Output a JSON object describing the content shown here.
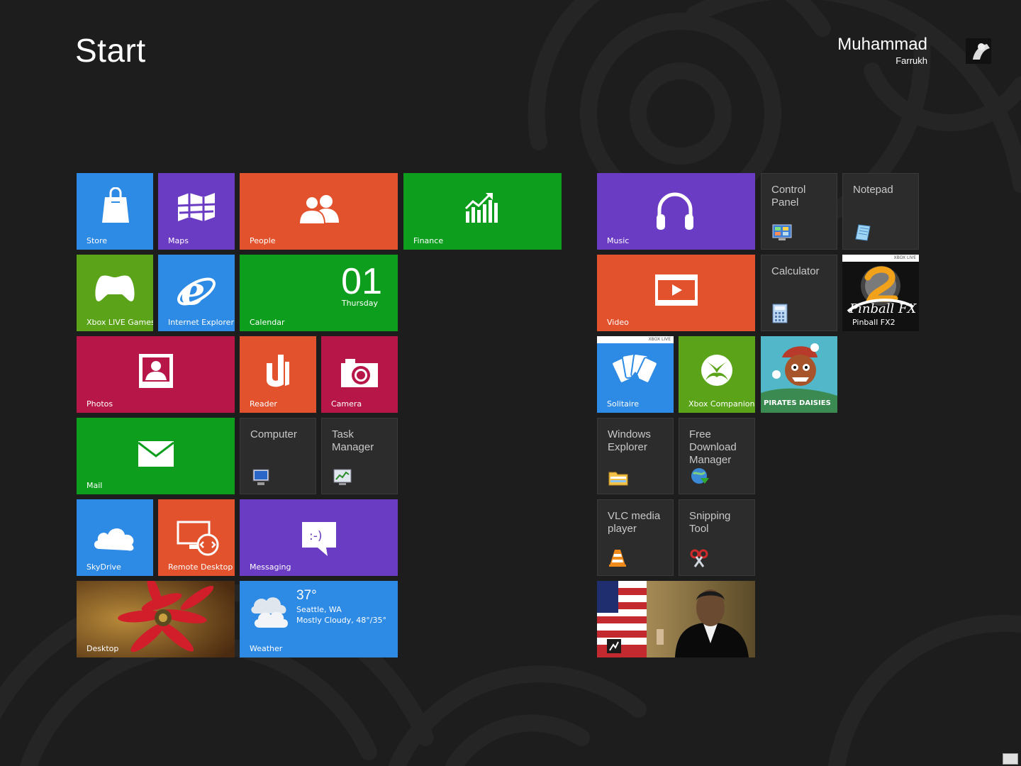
{
  "screen": {
    "title": "Start"
  },
  "user": {
    "first_name": "Muhammad",
    "last_name": "Farrukh"
  },
  "groups": {
    "group1": {
      "store": "Store",
      "maps": "Maps",
      "people": "People",
      "finance": "Finance",
      "xbox_live_games": "Xbox LIVE Games",
      "internet_explorer": "Internet Explorer",
      "calendar": {
        "label": "Calendar",
        "day": "01",
        "weekday": "Thursday"
      },
      "photos": "Photos",
      "reader": "Reader",
      "camera": "Camera",
      "mail": "Mail",
      "computer": "Computer",
      "task_manager": "Task\nManager",
      "skydrive": "SkyDrive",
      "remote_desktop": "Remote Desktop",
      "messaging": "Messaging",
      "desktop": "Desktop",
      "weather": {
        "label": "Weather",
        "temp": "37°",
        "city": "Seattle, WA",
        "condition": "Mostly Cloudy, 48°/35°"
      }
    },
    "group2": {
      "music": "Music",
      "control_panel": "Control\nPanel",
      "notepad": "Notepad",
      "video": "Video",
      "calculator": "Calculator",
      "pinball": "Pinball FX2",
      "xbox_live_badge": "XBOX LIVE",
      "solitaire": "Solitaire",
      "xbox_companion": "Xbox Companion",
      "pirates_game": "PIRATES DAISIES",
      "windows_explorer": "Windows\nExplorer",
      "free_download_manager": "Free\nDownload\nManager",
      "vlc": "VLC media\nplayer",
      "snipping_tool": "Snipping\nTool"
    }
  },
  "colors": {
    "background": "#1d1d1d",
    "blue": "#2d8ae5",
    "purple": "#6a3bc3",
    "orange": "#e2522d",
    "green": "#0d9e1e",
    "crimson": "#b71748",
    "dark_tile": "#2c2c2c"
  }
}
